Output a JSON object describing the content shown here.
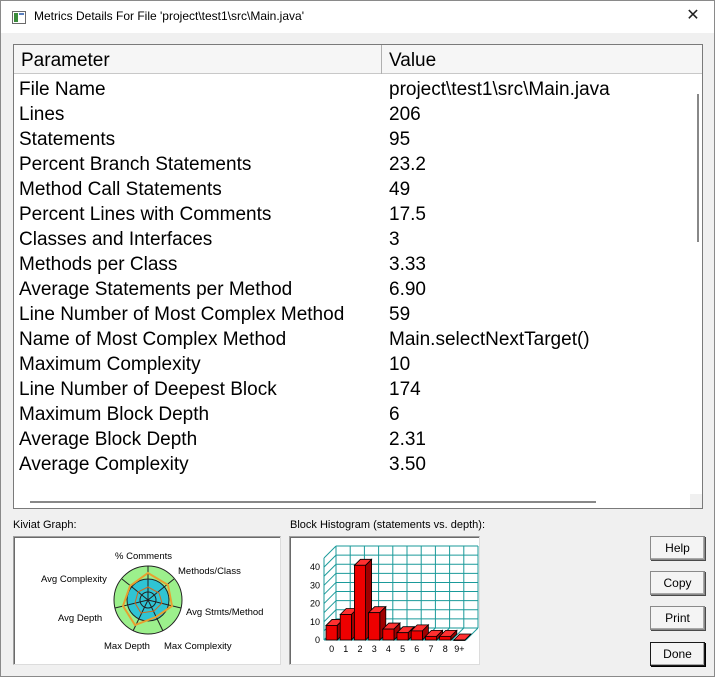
{
  "window": {
    "title": "Metrics Details For File 'project\\test1\\src\\Main.java'",
    "close_glyph": "✕"
  },
  "table": {
    "headers": {
      "parameter": "Parameter",
      "value": "Value"
    },
    "rows": [
      {
        "parameter": "File Name",
        "value": "project\\test1\\src\\Main.java"
      },
      {
        "parameter": "Lines",
        "value": "206"
      },
      {
        "parameter": "Statements",
        "value": "95"
      },
      {
        "parameter": "Percent Branch Statements",
        "value": "23.2"
      },
      {
        "parameter": "Method Call Statements",
        "value": "49"
      },
      {
        "parameter": "Percent Lines with Comments",
        "value": "17.5"
      },
      {
        "parameter": "Classes and Interfaces",
        "value": "3"
      },
      {
        "parameter": "Methods per Class",
        "value": "3.33"
      },
      {
        "parameter": "Average Statements per Method",
        "value": "6.90"
      },
      {
        "parameter": "Line Number of Most Complex Method",
        "value": "59"
      },
      {
        "parameter": "Name of Most Complex Method",
        "value": "Main.selectNextTarget()"
      },
      {
        "parameter": "Maximum Complexity",
        "value": "10"
      },
      {
        "parameter": "Line Number of Deepest Block",
        "value": "174"
      },
      {
        "parameter": "Maximum Block Depth",
        "value": "6"
      },
      {
        "parameter": "Average Block Depth",
        "value": "2.31"
      },
      {
        "parameter": "Average Complexity",
        "value": "3.50"
      }
    ]
  },
  "kiviat": {
    "label": "Kiviat Graph:",
    "axes": [
      "% Comments",
      "Methods/Class",
      "Avg Stmts/Method",
      "Max Complexity",
      "Max Depth",
      "Avg Depth",
      "Avg Complexity"
    ]
  },
  "histogram": {
    "label": "Block Histogram (statements vs. depth):"
  },
  "chart_data": {
    "type": "bar",
    "categories": [
      "0",
      "1",
      "2",
      "3",
      "4",
      "5",
      "6",
      "7",
      "8",
      "9+"
    ],
    "values": [
      8,
      14,
      41,
      15,
      6,
      4,
      5,
      2,
      2,
      0
    ],
    "ylim": [
      0,
      45
    ],
    "yticks": [
      "0",
      "10",
      "20",
      "30",
      "40"
    ],
    "bar_color": "#ee0000",
    "grid": true
  },
  "buttons": {
    "help": "Help",
    "copy": "Copy",
    "print": "Print",
    "done": "Done"
  },
  "colors": {
    "kiviat_outer": "#9cf08c",
    "kiviat_inner": "#2fc4d4",
    "kiviat_polygon": "#e8a030",
    "grid_line": "#1a9a9a"
  }
}
